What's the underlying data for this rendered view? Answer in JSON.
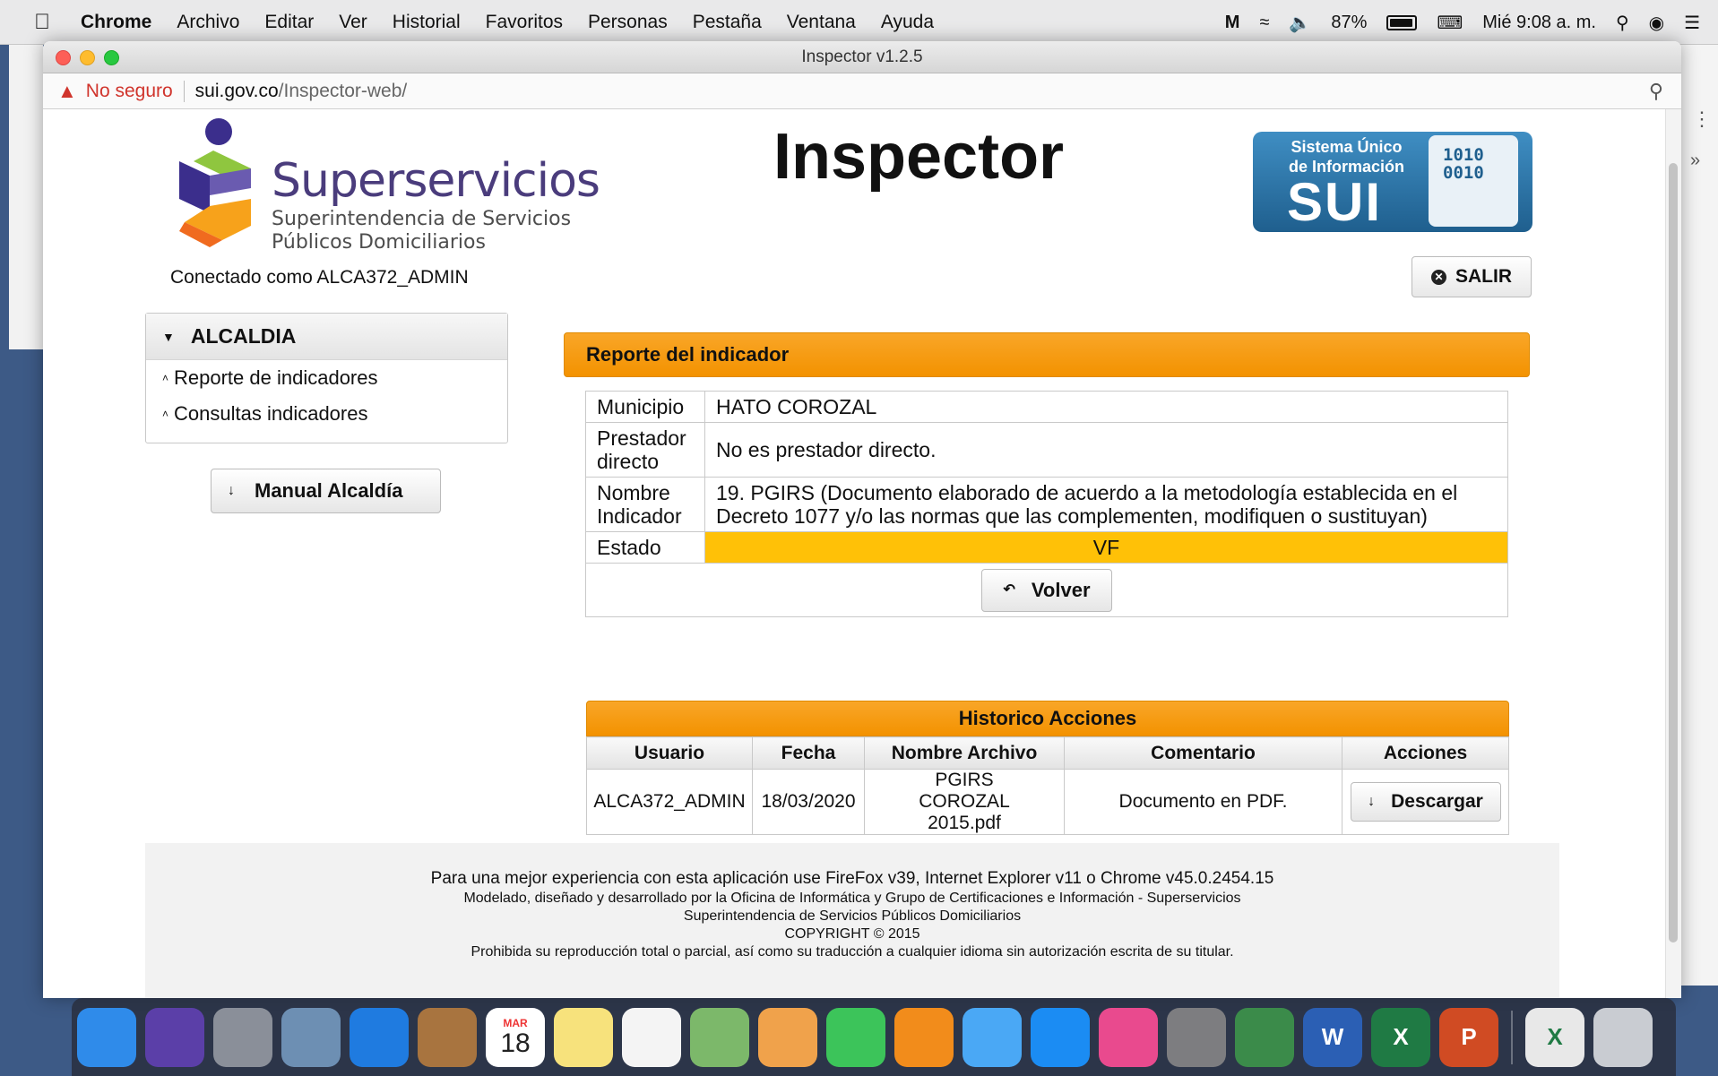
{
  "menubar": {
    "app": "Chrome",
    "items": [
      "Archivo",
      "Editar",
      "Ver",
      "Historial",
      "Favoritos",
      "Personas",
      "Pestaña",
      "Ventana",
      "Ayuda"
    ],
    "battery": "87%",
    "clock": "Mié 9:08 a. m."
  },
  "window": {
    "title": "Inspector v1.2.5"
  },
  "address": {
    "security": "No seguro",
    "host": "sui.gov.co",
    "path": "/Inspector-web/"
  },
  "header": {
    "brand": "Superservicios",
    "brand_sub1": "Superintendencia de Servicios",
    "brand_sub2": "Públicos Domiciliarios",
    "connected": "Conectado como ALCA372_ADMIN",
    "title": "Inspector",
    "sui_caption1": "Sistema Único",
    "sui_caption2": "de Información",
    "sui_name": "SUI",
    "sui_icon_line1": "1010",
    "sui_icon_line2": "0010",
    "salir": "SALIR"
  },
  "sidebar": {
    "section": "ALCALDIA",
    "items": [
      {
        "label": "Reporte de indicadores"
      },
      {
        "label": "Consultas indicadores"
      }
    ],
    "manual": "Manual Alcaldía"
  },
  "report": {
    "header": "Reporte del indicador",
    "rows": [
      {
        "label": "Municipio",
        "value": "HATO COROZAL"
      },
      {
        "label": "Prestador directo",
        "value": "No es prestador directo."
      },
      {
        "label": "Nombre Indicador",
        "value": "19. PGIRS (Documento elaborado de acuerdo a la metodología establecida en el Decreto 1077 y/o las normas que las complementen, modifiquen o sustituyan)"
      },
      {
        "label": "Estado",
        "value": "VF"
      }
    ],
    "volver": "Volver"
  },
  "historico": {
    "title": "Historico Acciones",
    "columns": [
      "Usuario",
      "Fecha",
      "Nombre Archivo",
      "Comentario",
      "Acciones"
    ],
    "rows": [
      {
        "usuario": "ALCA372_ADMIN",
        "fecha": "18/03/2020",
        "archivo": "PGIRS COROZAL 2015.pdf",
        "comentario": "Documento en PDF.",
        "accion": "Descargar"
      }
    ]
  },
  "footer": {
    "line1": "Para una mejor experiencia con esta aplicación use FireFox v39, Internet Explorer v11 o Chrome v45.0.2454.15",
    "line2": "Modelado, diseñado y desarrollado por la Oficina de Informática y Grupo de Certificaciones e Información - Superservicios",
    "line3": "Superintendencia de Servicios Públicos Domiciliarios",
    "line4": "COPYRIGHT © 2015",
    "line5": "Prohibida su reproducción total o parcial, así como su traducción a cualquier idioma sin autorización escrita de su titular."
  },
  "dock": {
    "calendar_month": "MAR",
    "calendar_day": "18",
    "apps": [
      {
        "icon": "finder-icon",
        "color": "#2f8bea"
      },
      {
        "icon": "siri-icon",
        "color": "#5b3fa8"
      },
      {
        "icon": "launchpad-icon",
        "color": "#8a8f99"
      },
      {
        "icon": "mail-stamp-icon",
        "color": "#6d8fb3"
      },
      {
        "icon": "safari-icon",
        "color": "#1f7be0"
      },
      {
        "icon": "contacts-icon",
        "color": "#a8743f"
      },
      {
        "icon": "calendar-icon",
        "color": "#ffffff"
      },
      {
        "icon": "notes-icon",
        "color": "#f7e27c"
      },
      {
        "icon": "reminders-icon",
        "color": "#f4f4f4"
      },
      {
        "icon": "maps-icon",
        "color": "#7cb86a"
      },
      {
        "icon": "photos-icon",
        "color": "#f0a24b"
      },
      {
        "icon": "facetime-icon",
        "color": "#3cc45a"
      },
      {
        "icon": "books-icon",
        "color": "#f28c1b"
      },
      {
        "icon": "messages-icon",
        "color": "#4aa8f5"
      },
      {
        "icon": "app-store-icon",
        "color": "#1b8cf3"
      },
      {
        "icon": "itunes-icon",
        "color": "#e94a8e"
      },
      {
        "icon": "system-preferences-icon",
        "color": "#7d7d80"
      },
      {
        "icon": "chrome-icon",
        "color": "#3b8b4a"
      },
      {
        "icon": "word-icon",
        "color": "#2b5fb4",
        "letter": "W"
      },
      {
        "icon": "excel-icon",
        "color": "#1f7a44",
        "letter": "X"
      },
      {
        "icon": "powerpoint-icon",
        "color": "#d04b23",
        "letter": "P"
      },
      {
        "icon": "excel-file-icon",
        "color": "#e8e8e8",
        "letter": "X"
      },
      {
        "icon": "trash-icon",
        "color": "#c9ccd2"
      }
    ]
  }
}
